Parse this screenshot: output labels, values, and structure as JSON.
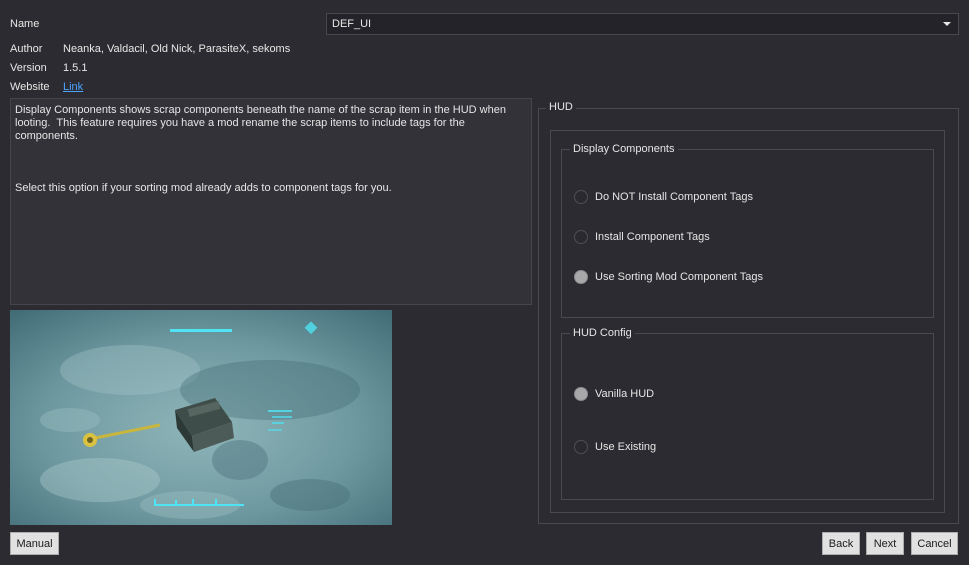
{
  "info": {
    "name_label": "Name",
    "name_value": "DEF_UI",
    "author_label": "Author",
    "author_value": "Neanka, Valdacil, Old Nick, ParasiteX, sekoms",
    "version_label": "Version",
    "version_value": "1.5.1",
    "website_label": "Website",
    "website_link": "Link"
  },
  "description": "Display Components shows scrap components beneath the name of the scrap item in the HUD when looting.  This feature requires you have a mod rename the scrap items to include tags for the components.\n\n\n\nSelect this option if your sorting mod already adds to component tags for you.",
  "hud": {
    "title": "HUD",
    "display_components": {
      "title": "Display Components",
      "options": [
        {
          "label": "Do NOT Install Component Tags",
          "checked": false
        },
        {
          "label": "Install Component Tags",
          "checked": false
        },
        {
          "label": "Use Sorting Mod Component Tags",
          "checked": true
        }
      ]
    },
    "hud_config": {
      "title": "HUD Config",
      "options": [
        {
          "label": "Vanilla HUD",
          "checked": true
        },
        {
          "label": "Use Existing",
          "checked": false
        }
      ]
    }
  },
  "buttons": {
    "manual": "Manual",
    "back": "Back",
    "next": "Next",
    "cancel": "Cancel"
  },
  "colors": {
    "background": "#2c2b31",
    "link": "#4aa3ff",
    "radio_checked": "#a8a8aa"
  }
}
